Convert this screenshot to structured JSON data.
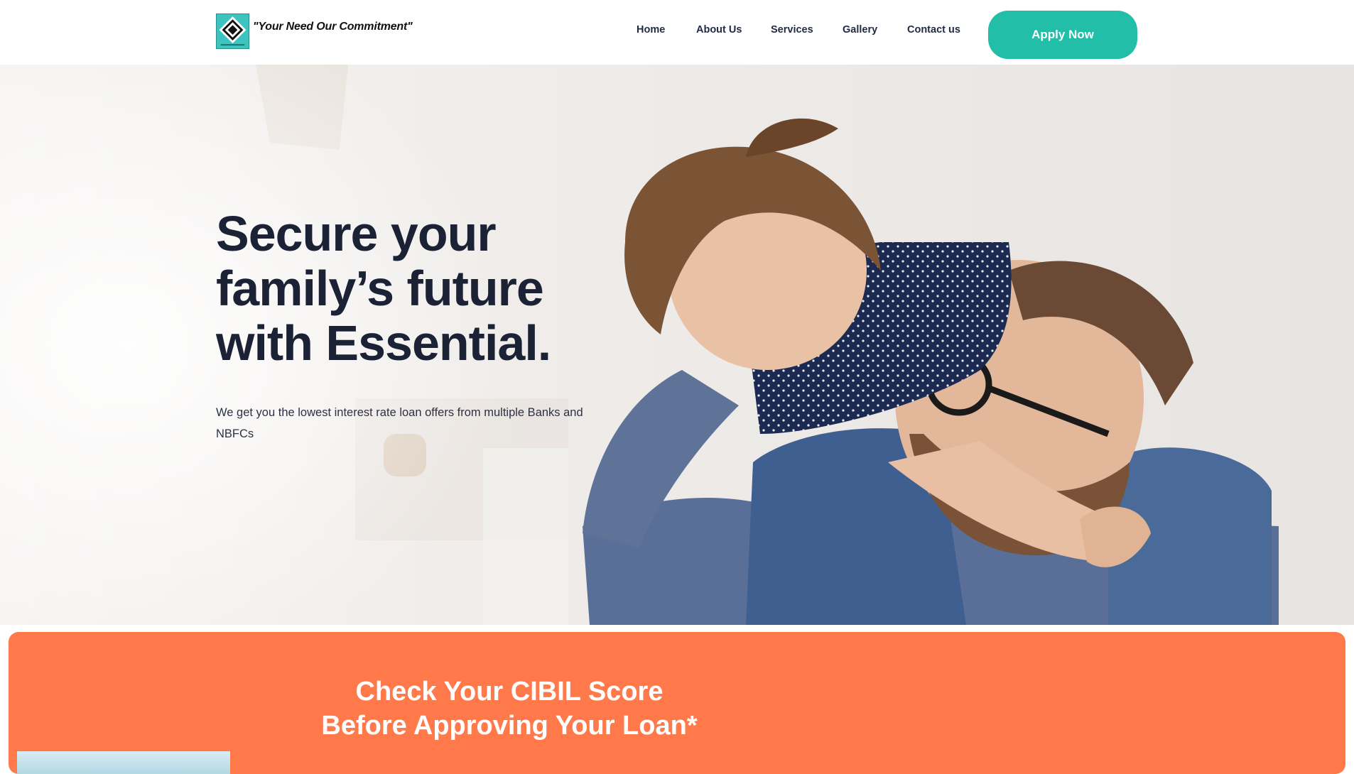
{
  "header": {
    "tagline": "\"Your Need Our Commitment\"",
    "nav": [
      {
        "label": "Home"
      },
      {
        "label": "About Us"
      },
      {
        "label": "Services"
      },
      {
        "label": "Gallery"
      },
      {
        "label": "Contact us"
      }
    ],
    "apply_label": "Apply Now"
  },
  "hero": {
    "title_lines": [
      "Secure your",
      "family’s future",
      "with Essential."
    ],
    "subtitle": "We get you the lowest interest rate loan offers from multiple Banks and NBFCs"
  },
  "cibil": {
    "title_lines": [
      "Check Your CIBIL Score",
      "Before Approving Your Loan*"
    ]
  },
  "colors": {
    "accent_teal": "#22bea8",
    "banner_orange": "#ff794b",
    "heading_navy": "#1b2235"
  }
}
